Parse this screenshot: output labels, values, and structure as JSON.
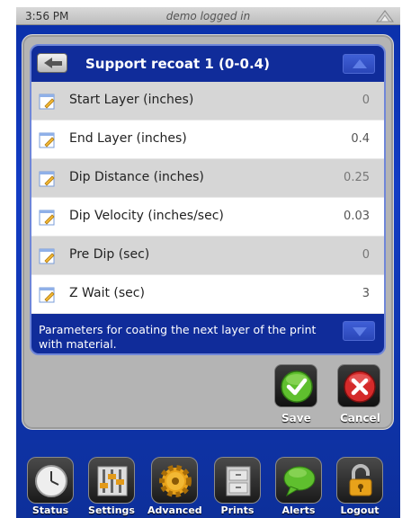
{
  "status_bar": {
    "time": "3:56 PM",
    "logged_text": "demo logged in",
    "signal_icon": "signal-icon"
  },
  "panel": {
    "title": "Support recoat 1 (0-0.4)",
    "rows": [
      {
        "label": "Start Layer (inches)",
        "value": "0"
      },
      {
        "label": "End Layer (inches)",
        "value": "0.4"
      },
      {
        "label": "Dip Distance (inches)",
        "value": "0.25"
      },
      {
        "label": "Dip Velocity (inches/sec)",
        "value": "0.03"
      },
      {
        "label": "Pre Dip (sec)",
        "value": "0"
      },
      {
        "label": "Z Wait (sec)",
        "value": "3"
      }
    ],
    "description": "Parameters for coating the next layer of the print with material.",
    "save_label": "Save",
    "cancel_label": "Cancel"
  },
  "dock": [
    {
      "label": "Status"
    },
    {
      "label": "Settings"
    },
    {
      "label": "Advanced"
    },
    {
      "label": "Prints"
    },
    {
      "label": "Alerts"
    },
    {
      "label": "Logout"
    }
  ],
  "colors": {
    "background": "#123cc4",
    "panel": "#b4b4b4",
    "save_green": "#5fbf2e",
    "cancel_red": "#d42a2a"
  }
}
